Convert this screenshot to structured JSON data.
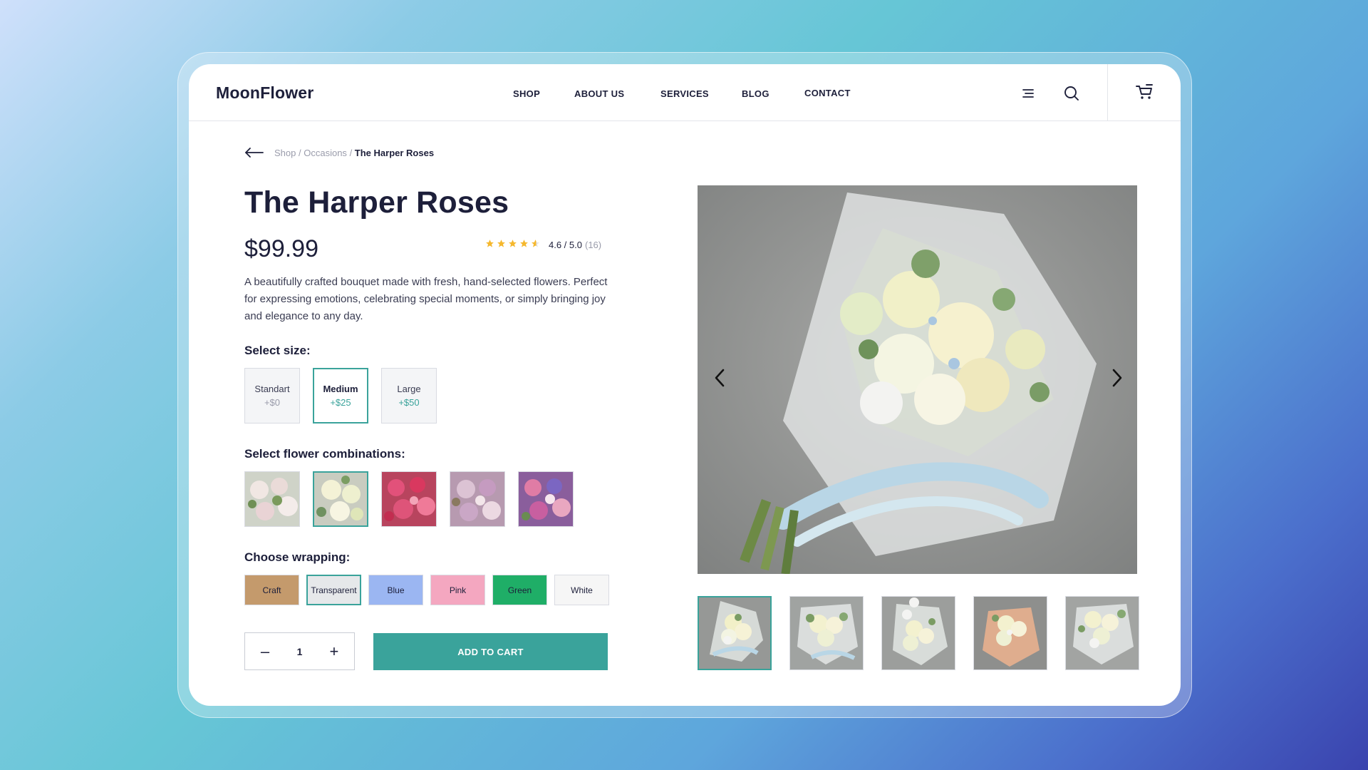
{
  "brand": {
    "name": "MoonFlower"
  },
  "nav": {
    "items": [
      {
        "label": "SHOP"
      },
      {
        "label": "ABOUT US"
      },
      {
        "label": "SERVICES"
      },
      {
        "label": "BLOG"
      },
      {
        "label": "CONTACT"
      }
    ]
  },
  "header_icons": [
    "menu-icon",
    "search-icon",
    "cart-icon"
  ],
  "breadcrumb": {
    "items": [
      "Shop",
      "Occasions"
    ],
    "current": "The Harper Roses"
  },
  "product": {
    "title": "The Harper Roses",
    "price": "$99.99",
    "rating": {
      "stars": 4.6,
      "text": "4.6 / 5.0",
      "count": "(16)"
    },
    "description": "A beautifully crafted bouquet made with fresh, hand-selected flowers. Perfect for expressing emotions, celebrating special moments, or simply bringing joy and elegance to any day."
  },
  "size": {
    "label": "Select size:",
    "options": [
      {
        "name": "Standart",
        "price": "+$0"
      },
      {
        "name": "Medium",
        "price": "+$25"
      },
      {
        "name": "Large",
        "price": "+$50"
      }
    ],
    "selected": 1
  },
  "combinations": {
    "label": "Select flower combinations:",
    "count": 5,
    "selected": 1
  },
  "wrapping": {
    "label": "Choose wrapping:",
    "options": [
      {
        "name": "Craft",
        "color": "#c49a6c"
      },
      {
        "name": "Transparent",
        "color": "#e6e8ea"
      },
      {
        "name": "Blue",
        "color": "#9bb6f2"
      },
      {
        "name": "Pink",
        "color": "#f4a7c0"
      },
      {
        "name": "Green",
        "color": "#1fae67"
      },
      {
        "name": "White",
        "color": "#f6f6f6"
      }
    ],
    "selected": 1
  },
  "cart": {
    "quantity": "1",
    "minus": "–",
    "plus": "+",
    "button": "ADD TO CART"
  },
  "gallery": {
    "thumbnails": 5,
    "selected": 0
  },
  "colors": {
    "accent": "#3aa39b",
    "text": "#1d1f3a",
    "muted": "#9a9cab",
    "star": "#f5b82e"
  }
}
